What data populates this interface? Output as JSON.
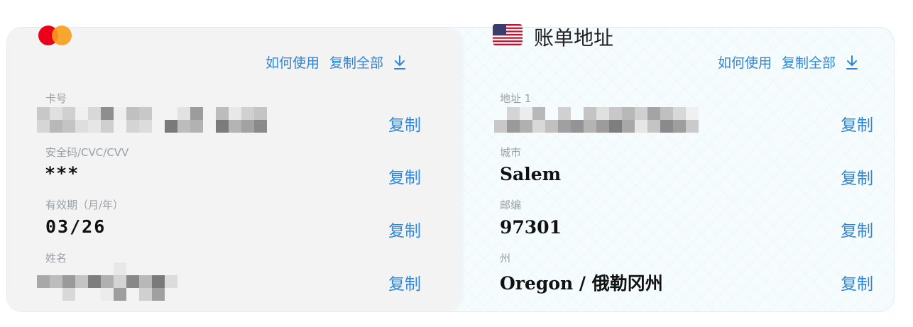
{
  "card_panel": {
    "brand_icon": "mastercard-logo",
    "how_to_use": "如何使用",
    "copy_all": "复制全部",
    "download_icon": "download-icon",
    "fields": [
      {
        "label": "卡号",
        "value": "",
        "copy": "复制"
      },
      {
        "label": "安全码/CVC/CVV",
        "value": "***",
        "copy": "复制"
      },
      {
        "label": "有效期（月/年）",
        "value": "03/26",
        "copy": "复制"
      },
      {
        "label": "姓名",
        "value": "",
        "copy": "复制"
      }
    ]
  },
  "billing_panel": {
    "flag_icon": "us-flag-icon",
    "title": "账单地址",
    "how_to_use": "如何使用",
    "copy_all": "复制全部",
    "download_icon": "download-icon",
    "fields": [
      {
        "label": "地址 1",
        "value": "",
        "copy": "复制"
      },
      {
        "label": "城市",
        "value": "Salem",
        "copy": "复制"
      },
      {
        "label": "邮编",
        "value": "97301",
        "copy": "复制"
      },
      {
        "label": "州",
        "value": "Oregon / 俄勒冈州",
        "copy": "复制"
      }
    ]
  },
  "colors": {
    "accent": "#2f86d8",
    "left_bg": "#f3f3f4",
    "right_bg": "#f6fcfe"
  }
}
